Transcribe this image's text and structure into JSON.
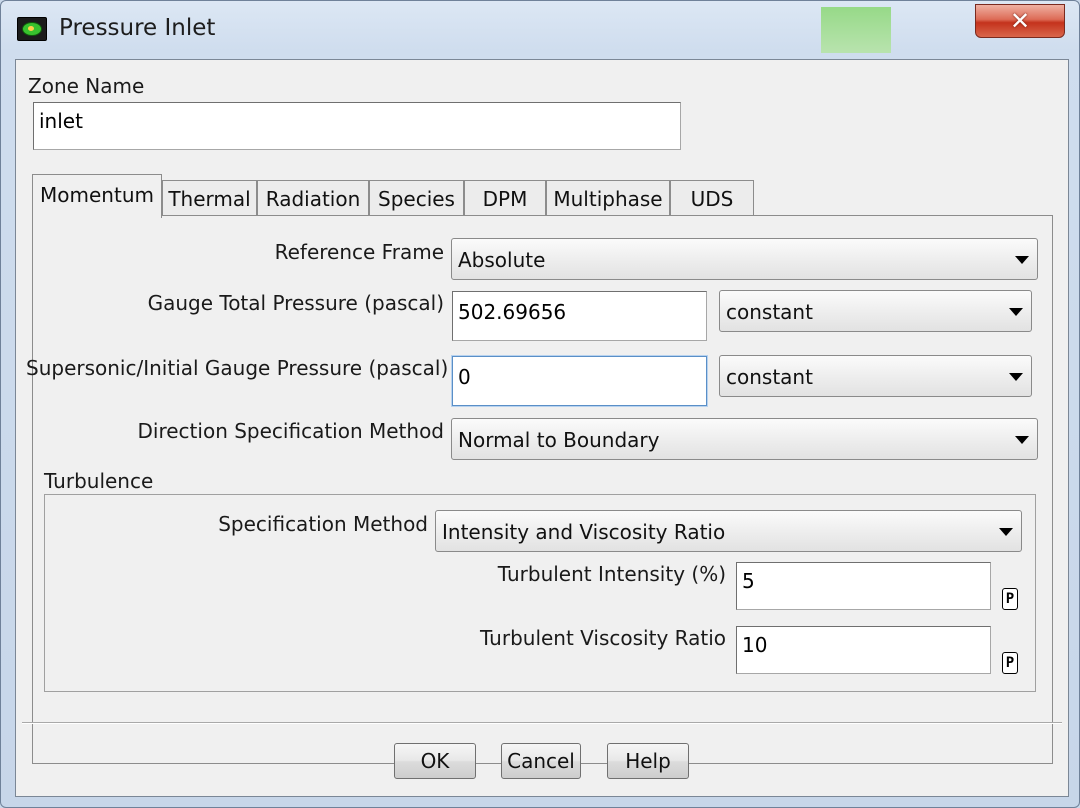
{
  "window": {
    "title": "Pressure Inlet",
    "close_glyph": "✕"
  },
  "zone": {
    "label": "Zone Name",
    "value": "inlet"
  },
  "tabs": [
    {
      "label": "Momentum",
      "active": true
    },
    {
      "label": "Thermal",
      "active": false
    },
    {
      "label": "Radiation",
      "active": false
    },
    {
      "label": "Species",
      "active": false
    },
    {
      "label": "DPM",
      "active": false
    },
    {
      "label": "Multiphase",
      "active": false
    },
    {
      "label": "UDS",
      "active": false
    }
  ],
  "momentum": {
    "reference_frame": {
      "label": "Reference Frame",
      "value": "Absolute"
    },
    "gauge_total_pressure": {
      "label": "Gauge Total Pressure (pascal)",
      "value": "502.69656",
      "method": "constant"
    },
    "supersonic_pressure": {
      "label": "Supersonic/Initial Gauge Pressure (pascal)",
      "value": "0",
      "method": "constant"
    },
    "direction_method": {
      "label": "Direction Specification Method",
      "value": "Normal to Boundary"
    }
  },
  "turbulence": {
    "group_label": "Turbulence",
    "spec_method": {
      "label": "Specification Method",
      "value": "Intensity and Viscosity Ratio"
    },
    "intensity": {
      "label": "Turbulent Intensity (%)",
      "value": "5",
      "param_glyph": "P"
    },
    "viscosity_ratio": {
      "label": "Turbulent Viscosity Ratio",
      "value": "10",
      "param_glyph": "P"
    }
  },
  "buttons": {
    "ok": "OK",
    "cancel": "Cancel",
    "help": "Help"
  },
  "icons": {
    "app": "fluent-eye-icon",
    "dropdown": "chevron-down-icon",
    "close": "close-icon",
    "parameter": "parameter-icon"
  }
}
